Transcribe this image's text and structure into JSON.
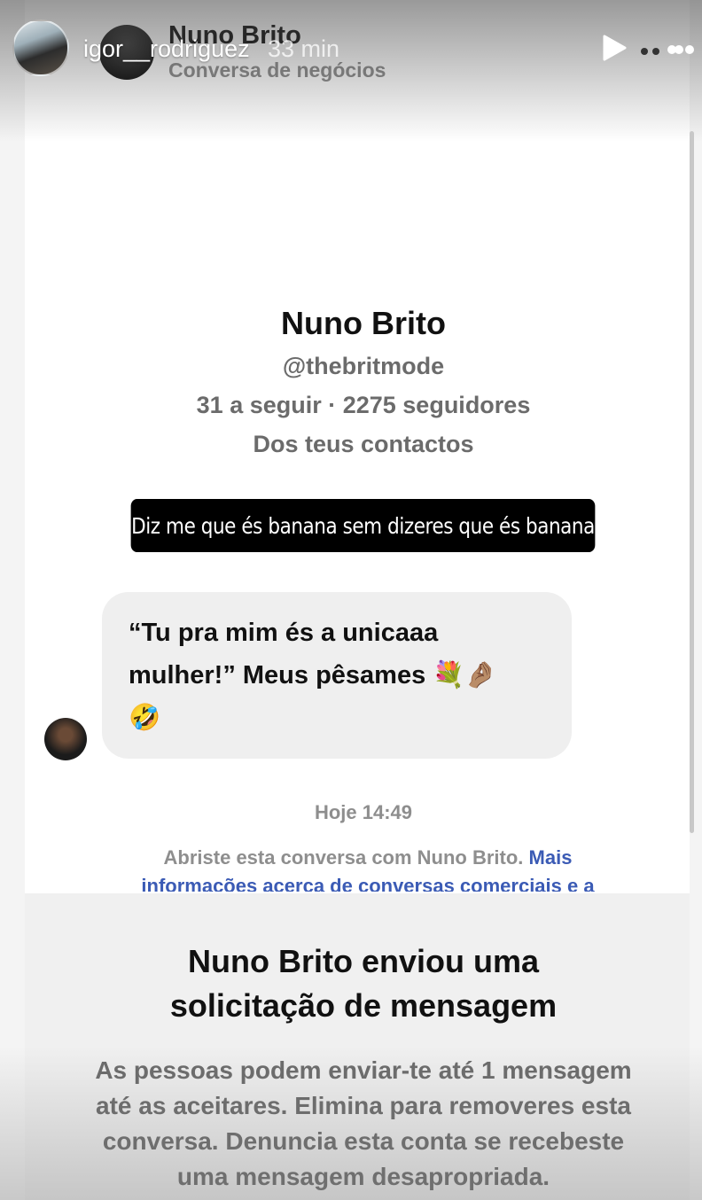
{
  "story": {
    "username": "igor__rodriguez",
    "time": "33 min",
    "icons": {
      "play": "play-icon",
      "more": "more-options-icon"
    }
  },
  "chat_header": {
    "name": "Nuno Brito",
    "subtitle": "Conversa de negócios"
  },
  "profile": {
    "name": "Nuno Brito",
    "handle": "@thebritmode",
    "stats": "31 a seguir · 2275 seguidores",
    "contacts": "Dos teus contactos"
  },
  "caption": "Diz me que és banana sem dizeres que és banana",
  "message": {
    "line1": "“Tu pra mim és a unicaaa",
    "line2": "mulher!” Meus pêsames 💐🤌🏽",
    "line3": "🤣"
  },
  "timestamp": "Hoje 14:49",
  "info": {
    "text": "Abriste esta conversa com Nuno Brito. ",
    "link": "Mais informações acerca de conversas comerciais e a"
  },
  "request": {
    "title_line1": "Nuno Brito enviou uma",
    "title_line2": "solicitação de mensagem",
    "body_line1": "As pessoas podem enviar-te até 1 mensagem",
    "body_line2": "até as aceitares. Elimina para removeres esta",
    "body_line3": "conversa. Denuncia esta conta se recebeste",
    "body_line4": "uma mensagem desapropriada."
  }
}
